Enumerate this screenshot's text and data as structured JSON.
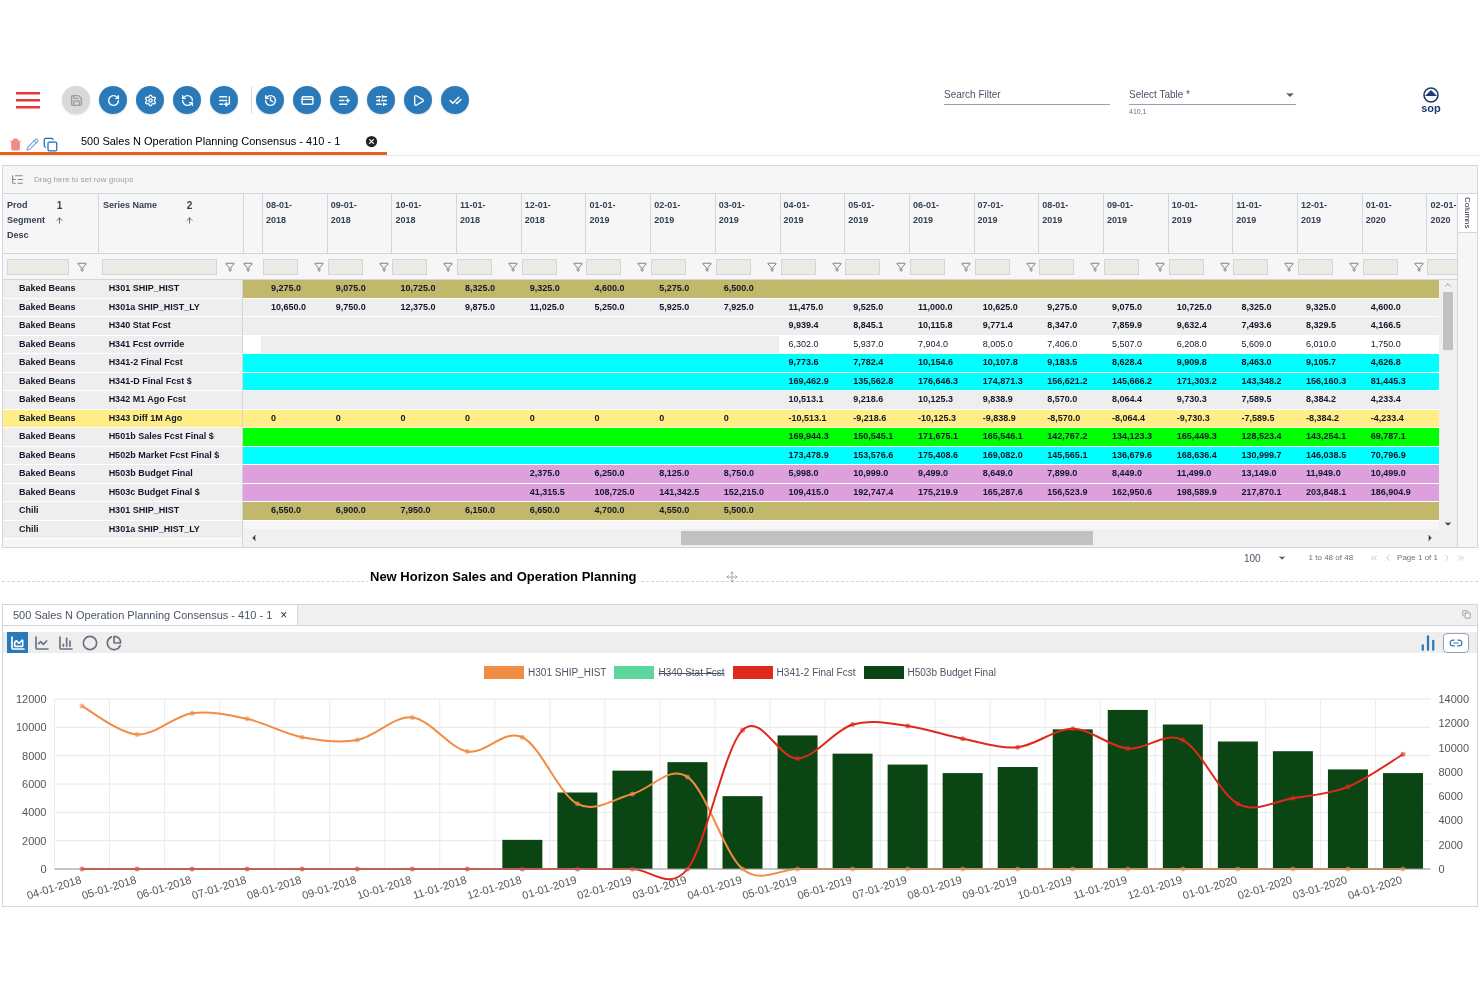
{
  "toolbar": {
    "buttons": [
      {
        "disabled": true
      },
      {
        "disabled": false
      },
      {
        "disabled": false
      },
      {
        "disabled": false
      },
      {
        "disabled": false
      },
      {
        "disabled": false
      },
      {
        "disabled": false
      },
      {
        "disabled": false
      },
      {
        "disabled": false
      },
      {
        "disabled": false
      },
      {
        "disabled": false
      }
    ]
  },
  "search": {
    "placeholder": "Search Filter"
  },
  "table_select": {
    "placeholder": "Select Table *",
    "hint": "410,1"
  },
  "logo": {
    "text": "sop"
  },
  "document_tab": {
    "label": "500 Sales N Operation Planning Consensus - 410 - 1",
    "selected": true
  },
  "grid": {
    "group_hint": "Drag here to set row groups",
    "side_tab": "Columns",
    "pinned_columns": [
      {
        "label": "Prod Segment Desc",
        "sort_index": "1"
      },
      {
        "label": "Series Name",
        "sort_index": "2"
      }
    ],
    "date_columns": [
      "08-01-2018",
      "09-01-2018",
      "10-01-2018",
      "11-01-2018",
      "12-01-2018",
      "01-01-2019",
      "02-01-2019",
      "03-01-2019",
      "04-01-2019",
      "05-01-2019",
      "06-01-2019",
      "07-01-2019",
      "08-01-2019",
      "09-01-2019",
      "10-01-2019",
      "11-01-2019",
      "12-01-2019",
      "01-01-2020",
      "02-01-2020"
    ],
    "rows": [
      {
        "segment": "Baked Beans",
        "series": "H301 SHIP_HIST",
        "color": "#c2b86c",
        "selected": false,
        "history": [
          "9,275.0",
          "9,075.0",
          "10,725.0",
          "8,325.0",
          "9,325.0",
          "4,600.0",
          "5,275.0",
          "6,500.0"
        ]
      },
      {
        "segment": "Baked Beans",
        "series": "H301a SHIP_HIST_LY",
        "color": "#eeeeee",
        "selected": false,
        "history": [
          "10,650.0",
          "9,750.0",
          "12,375.0",
          "9,875.0",
          "11,025.0",
          "5,250.0",
          "5,925.0",
          "7,925.0"
        ],
        "forecast": [
          "11,475.0",
          "9,525.0",
          "11,000.0",
          "10,625.0",
          "9,275.0",
          "9,075.0",
          "10,725.0",
          "8,325.0",
          "9,325.0",
          "4,600.0"
        ]
      },
      {
        "segment": "Baked Beans",
        "series": "H340 Stat Fcst",
        "color": "#eeeeee",
        "selected": false,
        "forecast": [
          "9,939.4",
          "8,845.1",
          "10,115.8",
          "9,771.4",
          "8,347.0",
          "7,859.9",
          "9,632.4",
          "7,493.6",
          "8,329.5",
          "4,166.5"
        ]
      },
      {
        "segment": "Baked Beans",
        "series": "H341 Fcst ovrride",
        "color": "#ffffff",
        "selected": false,
        "editable": true,
        "forecast": [
          "6,302.0",
          "5,937.0",
          "7,904.0",
          "8,005.0",
          "7,406.0",
          "5,507.0",
          "6,208.0",
          "5,609.0",
          "6,010.0",
          "1,750.0"
        ]
      },
      {
        "segment": "Baked Beans",
        "series": "H341-2 Final Fcst",
        "color": "#00ffff",
        "selected": false,
        "forecast": [
          "9,773.6",
          "7,782.4",
          "10,154.6",
          "10,107.8",
          "9,183.5",
          "8,628.4",
          "9,909.8",
          "8,463.0",
          "9,105.7",
          "4,626.8"
        ]
      },
      {
        "segment": "Baked Beans",
        "series": "H341-D Final Fcst $",
        "color": "#00ffff",
        "selected": false,
        "forecast": [
          "169,462.9",
          "135,562.8",
          "176,646.3",
          "174,871.3",
          "156,621.2",
          "145,666.2",
          "171,303.2",
          "143,348.2",
          "156,160.3",
          "81,445.3"
        ]
      },
      {
        "segment": "Baked Beans",
        "series": "H342 M1 Ago Fcst",
        "color": "#eeeeee",
        "selected": false,
        "forecast": [
          "10,513.1",
          "9,218.6",
          "10,125.3",
          "9,838.9",
          "8,570.0",
          "8,064.4",
          "9,730.3",
          "7,589.5",
          "8,384.2",
          "4,233.4"
        ]
      },
      {
        "segment": "Baked Beans",
        "series": "H343 Diff 1M Ago",
        "color": "#ffee88",
        "selected": true,
        "history": [
          "0",
          "0",
          "0",
          "0",
          "0",
          "0",
          "0",
          "0"
        ],
        "forecast": [
          "-10,513.1",
          "-9,218.6",
          "-10,125.3",
          "-9,838.9",
          "-8,570.0",
          "-8,064.4",
          "-9,730.3",
          "-7,589.5",
          "-8,384.2",
          "-4,233.4"
        ]
      },
      {
        "segment": "Baked Beans",
        "series": "H501b Sales Fcst Final $",
        "color": "#00ff00",
        "selected": false,
        "forecast": [
          "169,944.3",
          "150,545.1",
          "171,675.1",
          "165,546.1",
          "142,767.2",
          "134,123.3",
          "165,449.3",
          "128,523.4",
          "143,254.1",
          "69,787.1"
        ]
      },
      {
        "segment": "Baked Beans",
        "series": "H502b Market Fcst Final $",
        "color": "#00ffff",
        "selected": false,
        "forecast": [
          "173,478.9",
          "153,576.6",
          "175,408.6",
          "169,082.0",
          "145,565.1",
          "136,679.6",
          "168,636.4",
          "130,999.7",
          "146,038.5",
          "70,796.9"
        ]
      },
      {
        "segment": "Baked Beans",
        "series": "H503b Budget Final",
        "color": "#dda0dd",
        "selected": false,
        "history": [
          "2,375.0",
          "6,250.0",
          "8,125.0",
          "8,750.0"
        ],
        "forecast": [
          "5,998.0",
          "10,999.0",
          "9,499.0",
          "8,649.0",
          "7,899.0",
          "8,449.0",
          "11,499.0",
          "13,149.0",
          "11,949.0",
          "10,499.0"
        ]
      },
      {
        "segment": "Baked Beans",
        "series": "H503c Budget Final $",
        "color": "#dda0dd",
        "selected": false,
        "history": [
          "41,315.5",
          "108,725.0",
          "141,342.5",
          "152,215.0"
        ],
        "forecast": [
          "109,415.0",
          "192,747.4",
          "175,219.9",
          "165,287.6",
          "156,523.9",
          "162,950.6",
          "198,589.9",
          "217,870.1",
          "203,848.1",
          "186,904.9"
        ]
      },
      {
        "segment": "Chili",
        "series": "H301 SHIP_HIST",
        "color": "#c2b86c",
        "selected": false,
        "history": [
          "6,550.0",
          "6,900.0",
          "7,950.0",
          "6,150.0",
          "6,650.0",
          "4,700.0",
          "4,550.0",
          "5,500.0"
        ]
      },
      {
        "segment": "Chili",
        "series": "H301a SHIP_HIST_LY",
        "selected": false
      }
    ]
  },
  "pagination": {
    "page_size": "100",
    "range": "1 to 48 of 48",
    "page": "Page 1 of 1"
  },
  "title": "New Horizon Sales and Operation Planning",
  "chart_panel": {
    "tab": {
      "label": "500 Sales N Operation Planning Consensus - 410 - 1",
      "close": "×"
    },
    "chart_types": [
      {
        "selected": true
      },
      {
        "selected": false
      },
      {
        "selected": false
      },
      {
        "selected": false
      },
      {
        "selected": false
      }
    ],
    "chart_data": {
      "type": "bar",
      "stacked": false,
      "grid": true,
      "legend": "top",
      "categories": [
        "04-01-2018",
        "05-01-2018",
        "06-01-2018",
        "07-01-2018",
        "08-01-2018",
        "09-01-2018",
        "10-01-2018",
        "11-01-2018",
        "12-01-2018",
        "01-01-2019",
        "02-01-2019",
        "03-01-2019",
        "04-01-2019",
        "05-01-2019",
        "06-01-2019",
        "07-01-2019",
        "08-01-2019",
        "09-01-2019",
        "10-01-2019",
        "11-01-2019",
        "12-01-2019",
        "01-01-2020",
        "02-01-2020",
        "03-01-2020",
        "04-01-2020"
      ],
      "ylim": [
        0,
        12000
      ],
      "yticks": [
        0,
        2000,
        4000,
        6000,
        8000,
        10000,
        12000
      ],
      "y2lim": [
        0,
        14000
      ],
      "y2ticks": [
        0,
        2000,
        4000,
        6000,
        8000,
        10000,
        12000,
        14000
      ],
      "series": [
        {
          "name": "H301 SHIP_HIST",
          "color": "#f08c44",
          "type": "line",
          "values": [
            11500,
            9500,
            11000,
            10600,
            9300,
            9100,
            10700,
            8300,
            9300,
            4600,
            5300,
            6500,
            0,
            0,
            0,
            0,
            0,
            0,
            0,
            0,
            0,
            0,
            0,
            0,
            0
          ]
        },
        {
          "name": "H340 Stat Fcst",
          "color": "#5cd69c",
          "type": "line",
          "values": [
            null,
            null,
            null,
            null,
            null,
            null,
            null,
            null,
            null,
            null,
            null,
            null,
            null,
            null,
            null,
            null,
            null,
            null,
            null,
            null,
            null,
            null,
            null,
            null,
            null
          ]
        },
        {
          "name": "H341-2 Final Fcst",
          "color": "#e0281c",
          "type": "line",
          "values": [
            0,
            0,
            0,
            0,
            0,
            0,
            0,
            0,
            0,
            0,
            0,
            0,
            9800,
            7800,
            10200,
            10100,
            9200,
            8600,
            9900,
            8500,
            9100,
            4600,
            5000,
            5800,
            8100
          ]
        },
        {
          "name": "H503b Budget Final",
          "color": "#0b4514",
          "axis": "y2",
          "values": [
            null,
            null,
            null,
            null,
            null,
            null,
            null,
            null,
            2400,
            6300,
            8100,
            8800,
            6000,
            11000,
            9500,
            8600,
            7900,
            8400,
            11500,
            13100,
            11900,
            10500,
            9700,
            8200,
            7900
          ]
        }
      ]
    }
  }
}
